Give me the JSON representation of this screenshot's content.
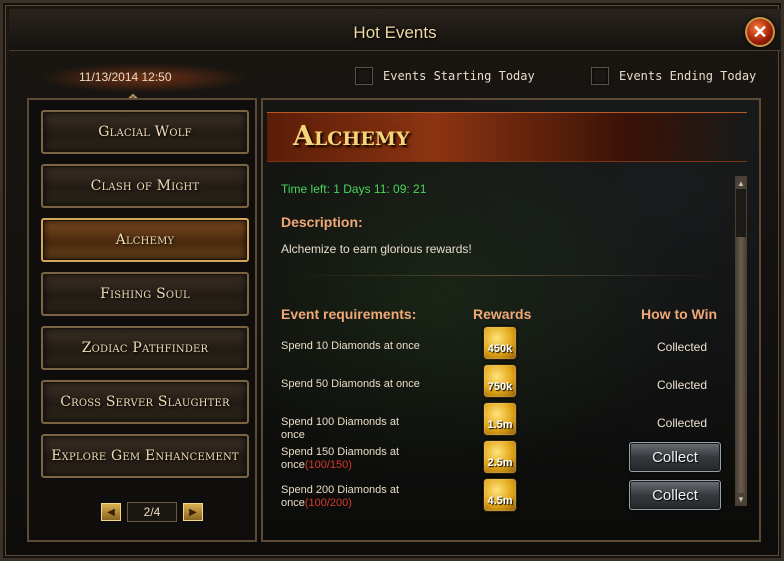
{
  "window": {
    "title": "Hot Events",
    "close_icon": "close-icon"
  },
  "header": {
    "datetime": "11/13/2014 12:50",
    "filter_starting": "Events Starting Today",
    "filter_ending": "Events Ending Today"
  },
  "sidebar": {
    "items": [
      {
        "label": "Glacial Wolf",
        "active": false
      },
      {
        "label": "Clash of Might",
        "active": false
      },
      {
        "label": "Alchemy",
        "active": true
      },
      {
        "label": "Fishing Soul",
        "active": false
      },
      {
        "label": "Zodiac Pathfinder",
        "active": false
      },
      {
        "label": "Cross Server Slaughter",
        "active": false
      },
      {
        "label": "Explore Gem Enhancement",
        "active": false
      }
    ],
    "pager": {
      "page": "2/4"
    }
  },
  "event": {
    "title": "Alchemy",
    "time_left": "Time left: 1 Days  11: 09: 21",
    "description_heading": "Description:",
    "description": "Alchemize to earn glorious rewards!",
    "col_requirements": "Event requirements:",
    "col_rewards": "Rewards",
    "col_how_to_win": "How to Win",
    "rows": [
      {
        "requirement": "Spend 10 Diamonds at once",
        "progress": "",
        "reward": "450k",
        "status": "Collected",
        "collect": false
      },
      {
        "requirement": "Spend 50 Diamonds at once",
        "progress": "",
        "reward": "750k",
        "status": "Collected",
        "collect": false
      },
      {
        "requirement": "Spend 100 Diamonds at once",
        "progress": "",
        "reward": "1.5m",
        "status": "Collected",
        "collect": false
      },
      {
        "requirement": "Spend 150 Diamonds at once",
        "progress": "(100/150)",
        "reward": "2.5m",
        "status": "Collect",
        "collect": true
      },
      {
        "requirement": "Spend 200 Diamonds at once",
        "progress": "(100/200)",
        "reward": "4.5m",
        "status": "Collect",
        "collect": true
      }
    ]
  },
  "colors": {
    "accent_gold": "#f6d57a",
    "heading_orange": "#f0a878",
    "time_green": "#47d65a",
    "progress_red": "#d63a2a"
  }
}
